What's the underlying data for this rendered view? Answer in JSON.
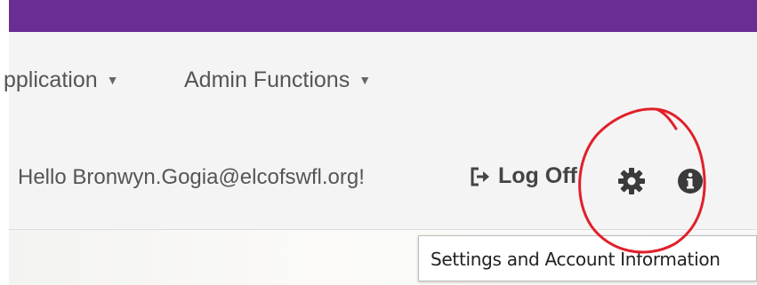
{
  "nav": {
    "application_label": "pplication",
    "admin_label": "Admin Functions"
  },
  "user": {
    "greeting": "Hello Bronwyn.Gogia@elcofswfl.org!",
    "logoff_label": "Log Off"
  },
  "tooltip": {
    "text": "Settings and Account Information"
  },
  "colors": {
    "brand_purple": "#6a2d93",
    "annotation_red": "#e0202a",
    "text_gray": "#555555"
  },
  "icons": {
    "logoff": "sign-out-icon",
    "settings": "gear-icon",
    "info": "info-circle-icon"
  }
}
